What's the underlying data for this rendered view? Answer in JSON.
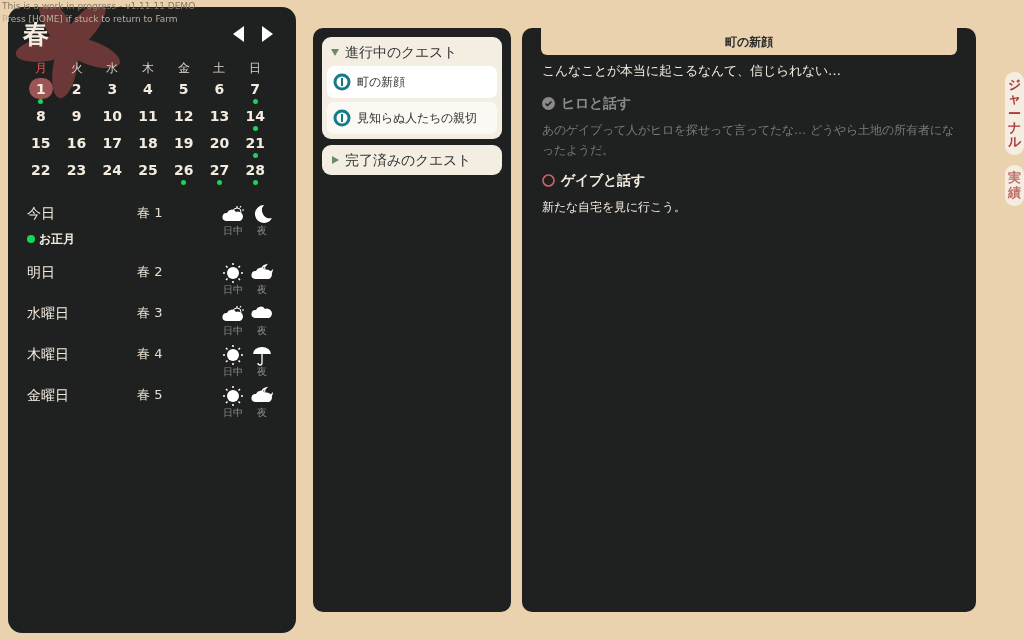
{
  "debug_lines": [
    "This is a work in progress - v1.11.11 DEMO",
    "Press [HOME] if stuck to return to Farm"
  ],
  "calendar": {
    "season": "春",
    "weekdays": [
      {
        "label": "月",
        "selected": true
      },
      {
        "label": "火",
        "selected": false
      },
      {
        "label": "水",
        "selected": false
      },
      {
        "label": "木",
        "selected": false
      },
      {
        "label": "金",
        "selected": false
      },
      {
        "label": "土",
        "selected": false
      },
      {
        "label": "日",
        "selected": false
      }
    ],
    "days": [
      {
        "label": "1",
        "selected": true,
        "event": true
      },
      {
        "label": "2",
        "selected": false,
        "event": false
      },
      {
        "label": "3",
        "selected": false,
        "event": false
      },
      {
        "label": "4",
        "selected": false,
        "event": false
      },
      {
        "label": "5",
        "selected": false,
        "event": false
      },
      {
        "label": "6",
        "selected": false,
        "event": false
      },
      {
        "label": "7",
        "selected": false,
        "event": true
      },
      {
        "label": "8",
        "selected": false,
        "event": false
      },
      {
        "label": "9",
        "selected": false,
        "event": false
      },
      {
        "label": "10",
        "selected": false,
        "event": false
      },
      {
        "label": "11",
        "selected": false,
        "event": false
      },
      {
        "label": "12",
        "selected": false,
        "event": false
      },
      {
        "label": "13",
        "selected": false,
        "event": false
      },
      {
        "label": "14",
        "selected": false,
        "event": true
      },
      {
        "label": "15",
        "selected": false,
        "event": false
      },
      {
        "label": "16",
        "selected": false,
        "event": false
      },
      {
        "label": "17",
        "selected": false,
        "event": false
      },
      {
        "label": "18",
        "selected": false,
        "event": false
      },
      {
        "label": "19",
        "selected": false,
        "event": false
      },
      {
        "label": "20",
        "selected": false,
        "event": false
      },
      {
        "label": "21",
        "selected": false,
        "event": true
      },
      {
        "label": "22",
        "selected": false,
        "event": false
      },
      {
        "label": "23",
        "selected": false,
        "event": false
      },
      {
        "label": "24",
        "selected": false,
        "event": false
      },
      {
        "label": "25",
        "selected": false,
        "event": false
      },
      {
        "label": "26",
        "selected": false,
        "event": true
      },
      {
        "label": "27",
        "selected": false,
        "event": true
      },
      {
        "label": "28",
        "selected": false,
        "event": true
      }
    ]
  },
  "forecast": [
    {
      "day": "今日",
      "date": "春 1",
      "event": "お正月",
      "weather": [
        {
          "kind": "partly_cloudy",
          "label": "日中"
        },
        {
          "kind": "moon",
          "label": "夜"
        }
      ]
    },
    {
      "day": "明日",
      "date": "春 2",
      "weather": [
        {
          "kind": "sun",
          "label": "日中"
        },
        {
          "kind": "cloudy_moon",
          "label": "夜"
        }
      ]
    },
    {
      "day": "水曜日",
      "date": "春 3",
      "weather": [
        {
          "kind": "partly_cloudy",
          "label": "日中"
        },
        {
          "kind": "cloud",
          "label": "夜"
        }
      ]
    },
    {
      "day": "木曜日",
      "date": "春 4",
      "weather": [
        {
          "kind": "sun",
          "label": "日中"
        },
        {
          "kind": "rain",
          "label": "夜"
        }
      ]
    },
    {
      "day": "金曜日",
      "date": "春 5",
      "weather": [
        {
          "kind": "sun",
          "label": "日中"
        },
        {
          "kind": "cloudy_moon",
          "label": "夜"
        }
      ]
    }
  ],
  "quest_sections": [
    {
      "title": "進行中のクエスト",
      "expanded": true,
      "quests": [
        {
          "title": "町の新顔",
          "selected": true
        },
        {
          "title": "見知らぬ人たちの親切",
          "selected": false
        }
      ]
    },
    {
      "title": "完了済みのクエスト",
      "expanded": false
    }
  ],
  "quest_detail": {
    "title": "町の新顔",
    "intro": "こんなことが本当に起こるなんて、信じられない…",
    "objectives": [
      {
        "title": "ヒロと話す",
        "done": true,
        "text": "あのゲイブって人がヒロを探せって言ってたな… どうやら土地の所有者になったようだ。"
      },
      {
        "title": "ゲイブと話す",
        "done": false,
        "text": "新たな自宅を見に行こう。"
      }
    ]
  },
  "side_tabs": [
    {
      "label": "ジャーナル",
      "selected": true
    },
    {
      "label": "実績",
      "selected": false
    }
  ]
}
